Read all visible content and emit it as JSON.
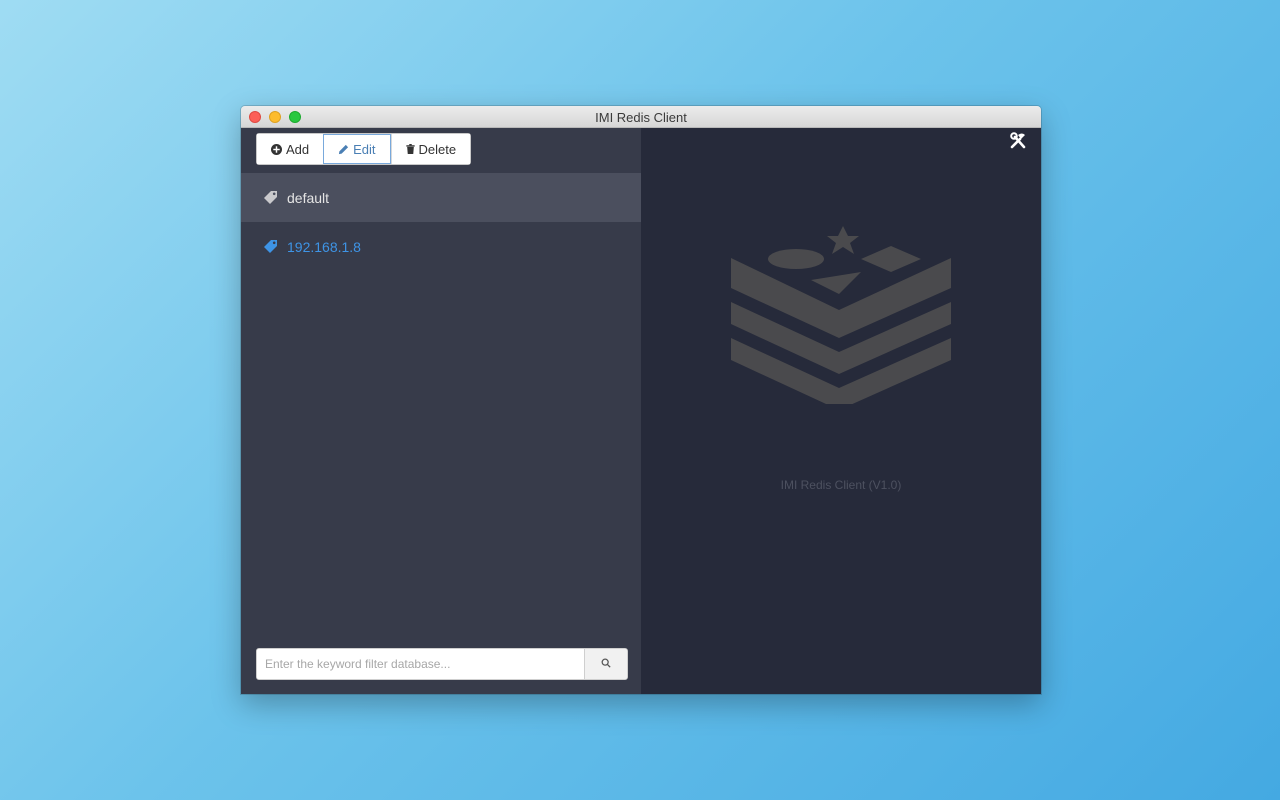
{
  "window": {
    "title": "IMI Redis Client"
  },
  "toolbar": {
    "add_label": "Add",
    "edit_label": "Edit",
    "delete_label": "Delete"
  },
  "connections": [
    {
      "name": "default",
      "state": "selected"
    },
    {
      "name": "192.168.1.8",
      "state": "link"
    }
  ],
  "search": {
    "placeholder": "Enter the keyword filter database..."
  },
  "main": {
    "version_text": "IMI Redis Client (V1.0)"
  },
  "icons": {
    "add": "plus-circle-icon",
    "edit": "pencil-icon",
    "delete": "trash-icon",
    "connection": "tag-icon",
    "search": "search-icon",
    "tools": "tools-icon",
    "logo": "redis-logo-icon"
  },
  "colors": {
    "sidebar_bg": "#373b4a",
    "main_bg": "#262a3a",
    "selected_row_bg": "#4b4f5e",
    "link_color": "#3e94e6",
    "logo_color": "#4a4a4d"
  }
}
